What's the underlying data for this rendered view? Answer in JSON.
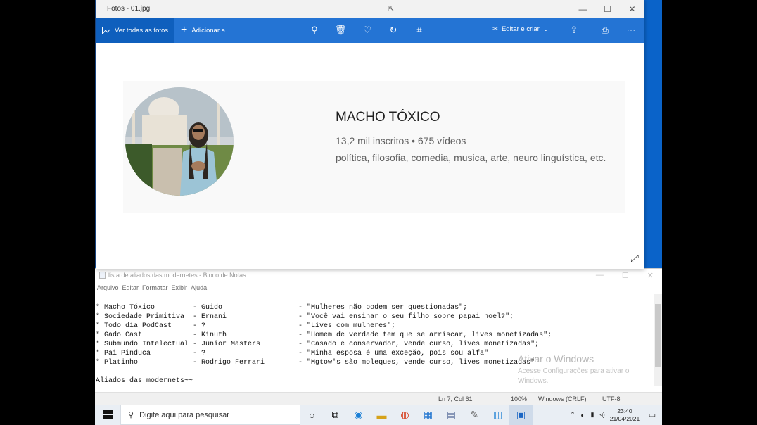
{
  "photos": {
    "title": "Fotos - 01.jpg",
    "controls": {
      "min": "—",
      "max": "☐",
      "close": "✕"
    },
    "see_all": "Ver todas as fotos",
    "add": "Adicionar a",
    "edit_create": "Editar e criar",
    "channel": {
      "name": "MACHO TÓXICO",
      "stats": "13,2 mil inscritos • 675 vídeos",
      "description": "política, filosofia, comedia, musica, arte, neuro linguística, etc."
    }
  },
  "notepad": {
    "title": "lista de aliados das modernetes - Bloco de Notas",
    "menu": [
      "Arquivo",
      "Editar",
      "Formatar",
      "Exibir",
      "Ajuda"
    ],
    "lines": [
      "* Macho Tóxico         - Guido                  - \"Mulheres não podem ser questionadas\";",
      "* Sociedade Primitiva  - Ernani                 - \"Você vai ensinar o seu filho sobre papai noel?\";",
      "* Todo dia PodCast     - ?                      - \"Lives com mulheres\";",
      "* Gado Cast            - Kinuth                 - \"Homem de verdade tem que se arriscar, lives monetizadas\";",
      "* Submundo Intelectual - Junior Masters         - \"Casado e conservador, vende curso, lives monetizadas\";",
      "* Pai Pinduca          - ?                      - \"Minha esposa é uma exceção, pois sou alfa\"",
      "* Platinho             - Rodrigo Ferrari        - \"Mgtow's são moleques, vende curso, lives monetizadas\"",
      "",
      "Aliados das modernets~~"
    ],
    "status": {
      "position": "Ln 7, Col 61",
      "zoom": "100%",
      "eol": "Windows (CRLF)",
      "encoding": "UTF-8"
    },
    "watermark_title": "Ativar o Windows",
    "watermark_text": "Acesse Configurações para ativar o Windows."
  },
  "taskbar": {
    "search_placeholder": "Digite aqui para pesquisar",
    "time": "23:40",
    "date": "21/04/2021"
  }
}
